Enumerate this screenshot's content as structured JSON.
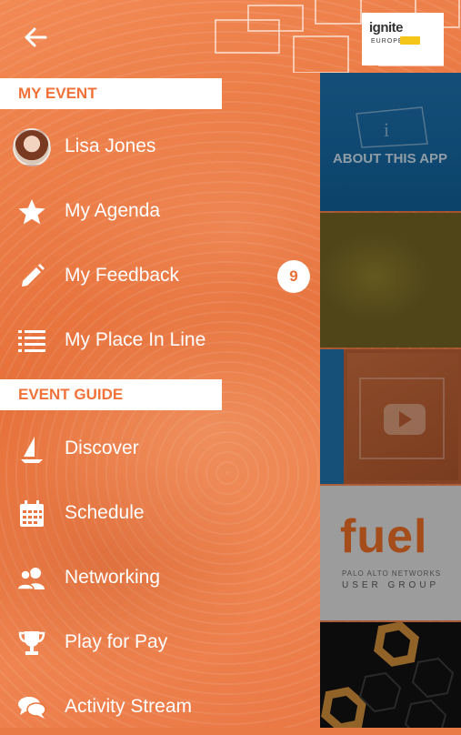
{
  "header": {
    "back_icon": "arrow-left-icon",
    "logo": {
      "text": "ignite",
      "sub": "EUROPE"
    }
  },
  "colors": {
    "accent": "#f07238",
    "header_bg": "#ffffff",
    "text": "#ffffff"
  },
  "sections": {
    "my_event": {
      "title": "MY EVENT"
    },
    "event_guide": {
      "title": "EVENT GUIDE"
    }
  },
  "menu": {
    "profile": {
      "label": "Lisa Jones"
    },
    "agenda": {
      "label": "My Agenda",
      "icon": "star-icon"
    },
    "feedback": {
      "label": "My Feedback",
      "icon": "pencil-icon",
      "badge": "9"
    },
    "place_in_line": {
      "label": "My Place In Line",
      "icon": "list-icon"
    },
    "discover": {
      "label": "Discover",
      "icon": "sailboat-icon"
    },
    "schedule": {
      "label": "Schedule",
      "icon": "calendar-icon"
    },
    "networking": {
      "label": "Networking",
      "icon": "people-icon"
    },
    "play_for_pay": {
      "label": "Play for Pay",
      "icon": "trophy-icon"
    },
    "activity_stream": {
      "label": "Activity Stream",
      "icon": "chat-icon"
    }
  },
  "tiles": {
    "about": {
      "label": "ABOUT THIS APP"
    },
    "fuel": {
      "title": "fuel",
      "sub1": "PALO ALTO NETWORKS",
      "sub2": "USER GROUP"
    }
  }
}
